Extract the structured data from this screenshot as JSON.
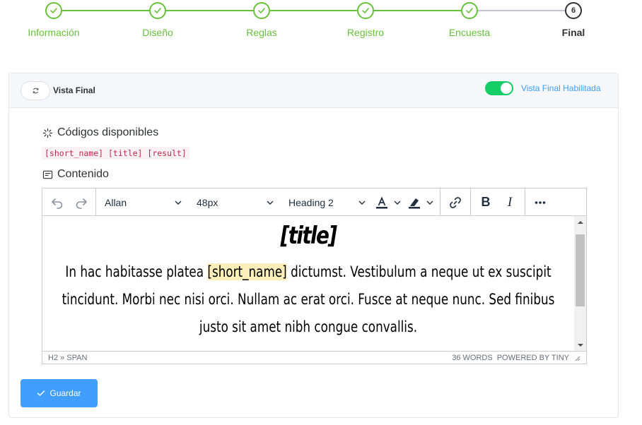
{
  "stepper": {
    "steps": [
      {
        "label": "Información",
        "state": "done"
      },
      {
        "label": "Diseño",
        "state": "done"
      },
      {
        "label": "Reglas",
        "state": "done"
      },
      {
        "label": "Registro",
        "state": "done"
      },
      {
        "label": "Encuesta",
        "state": "done"
      },
      {
        "label": "Final",
        "state": "current",
        "number": "6"
      }
    ]
  },
  "card": {
    "title": "Vista Final",
    "toggle_label": "Vista Final Habilitada",
    "toggle_on": true,
    "codes_label": "Códigos disponibles",
    "codes": "[short_name] [title] [result]",
    "content_label": "Contenido"
  },
  "editor": {
    "font_family": "Allan",
    "font_size": "48px",
    "block_format": "Heading 2",
    "doc_title": "[title]",
    "doc_text_before": "In hac habitasse platea ",
    "doc_highlight": "[short_name]",
    "doc_text_after": " dictumst. Vestibulum a neque ut ex suscipit tincidunt. Morbi nec nisi orci. Nullam ac erat orci. Fusce at neque nunc. Sed finibus justo sit amet nibh congue convallis.",
    "path": "H2 » SPAN",
    "word_count": "36 WORDS",
    "powered_by": "POWERED BY TINY"
  },
  "actions": {
    "save_label": "Guardar"
  },
  "colors": {
    "step_done": "#67c23a",
    "primary": "#409eff",
    "switch_on": "#13ce66",
    "highlight": "#fbeeb8"
  }
}
